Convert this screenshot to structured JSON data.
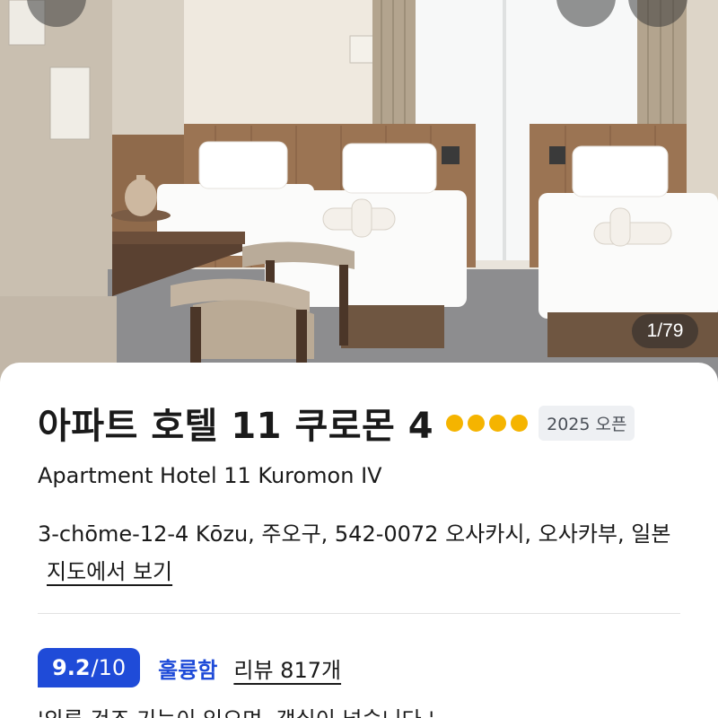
{
  "gallery": {
    "counter": "1/79"
  },
  "hotel": {
    "name_local": "아파트 호텔 11 쿠로몬 4",
    "star_rating": 4,
    "badge": "2025 오픈",
    "name_en": "Apartment Hotel 11 Kuromon IV",
    "address": "3-chōme-12-4 Kōzu, 주오구, 542-0072 오사카시, 오사카부, 일본",
    "map_link": "지도에서 보기"
  },
  "rating": {
    "score": "9.2",
    "scale": "/10",
    "label": "훌륭함",
    "reviews": "리뷰 817개",
    "quote": "'의류 건조 기능이 있으며, 객실이 넓습니다.'"
  },
  "colors": {
    "accent": "#1f4bd8",
    "star": "#f5b400"
  },
  "icons": [
    "back-icon",
    "favorite-icon",
    "share-icon"
  ]
}
